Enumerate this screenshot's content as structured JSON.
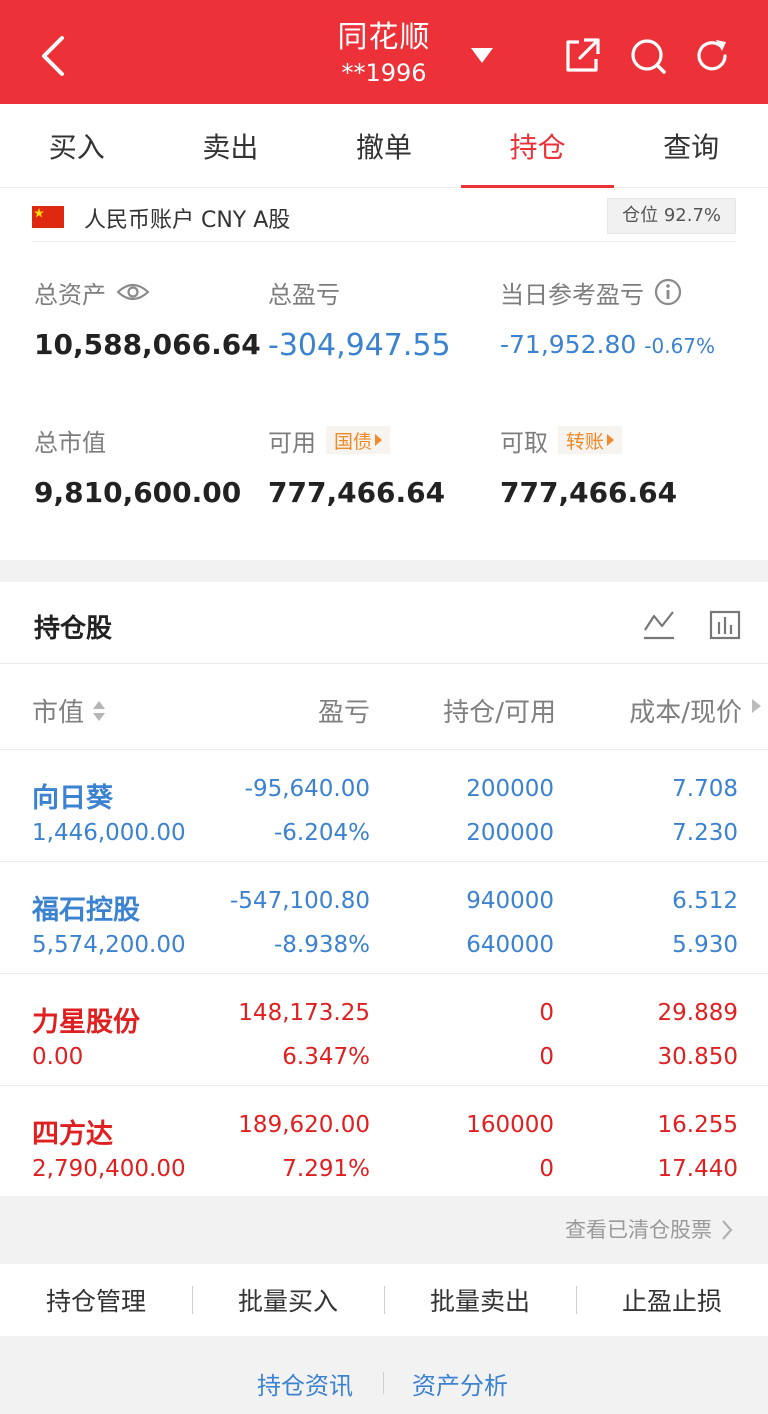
{
  "header": {
    "title": "同花顺",
    "account_masked": "**1996",
    "bg_color": "#ec3238",
    "icons": [
      "back-icon",
      "dropdown-caret-icon",
      "share-icon",
      "search-icon",
      "refresh-icon"
    ]
  },
  "tabs": [
    {
      "label": "买入"
    },
    {
      "label": "卖出"
    },
    {
      "label": "撤单"
    },
    {
      "label": "持仓",
      "active": true
    },
    {
      "label": "查询"
    }
  ],
  "account": {
    "currency_label": "人民币账户 CNY A股",
    "position_badge": "仓位 92.7%",
    "total_assets_label": "总资产",
    "total_assets": "10,588,066.64",
    "total_pnl_label": "总盈亏",
    "total_pnl": "-304,947.55",
    "daily_pnl_label": "当日参考盈亏",
    "daily_pnl": "-71,952.80",
    "daily_pnl_pct": "-0.67%",
    "market_value_label": "总市值",
    "market_value": "9,810,600.00",
    "available_label": "可用",
    "available_tag": "国债",
    "available": "777,466.64",
    "withdrawable_label": "可取",
    "withdrawable_tag": "转账",
    "withdrawable": "777,466.64"
  },
  "holdings": {
    "title": "持仓股",
    "columns": {
      "market_value": "市值",
      "pnl": "盈亏",
      "position": "持仓/可用",
      "cost_price": "成本/现价"
    },
    "rows": [
      {
        "name": "向日葵",
        "market_value": "1,446,000.00",
        "pnl": "-95,640.00",
        "pnl_pct": "-6.204%",
        "position": "200000",
        "available": "200000",
        "cost": "7.708",
        "price": "7.230",
        "color": "blue"
      },
      {
        "name": "福石控股",
        "market_value": "5,574,200.00",
        "pnl": "-547,100.80",
        "pnl_pct": "-8.938%",
        "position": "940000",
        "available": "640000",
        "cost": "6.512",
        "price": "5.930",
        "color": "blue"
      },
      {
        "name": "力星股份",
        "market_value": "0.00",
        "pnl": "148,173.25",
        "pnl_pct": "6.347%",
        "position": "0",
        "available": "0",
        "cost": "29.889",
        "price": "30.850",
        "color": "red"
      },
      {
        "name": "四方达",
        "market_value": "2,790,400.00",
        "pnl": "189,620.00",
        "pnl_pct": "7.291%",
        "position": "160000",
        "available": "0",
        "cost": "16.255",
        "price": "17.440",
        "color": "red"
      }
    ],
    "view_cleared": "查看已清仓股票"
  },
  "actions": [
    "持仓管理",
    "批量买入",
    "批量卖出",
    "止盈止损"
  ],
  "footer": [
    "持仓资讯",
    "资产分析"
  ],
  "colors": {
    "red": "#e02020",
    "blue": "#3b82d1",
    "orange": "#f08a2a"
  }
}
